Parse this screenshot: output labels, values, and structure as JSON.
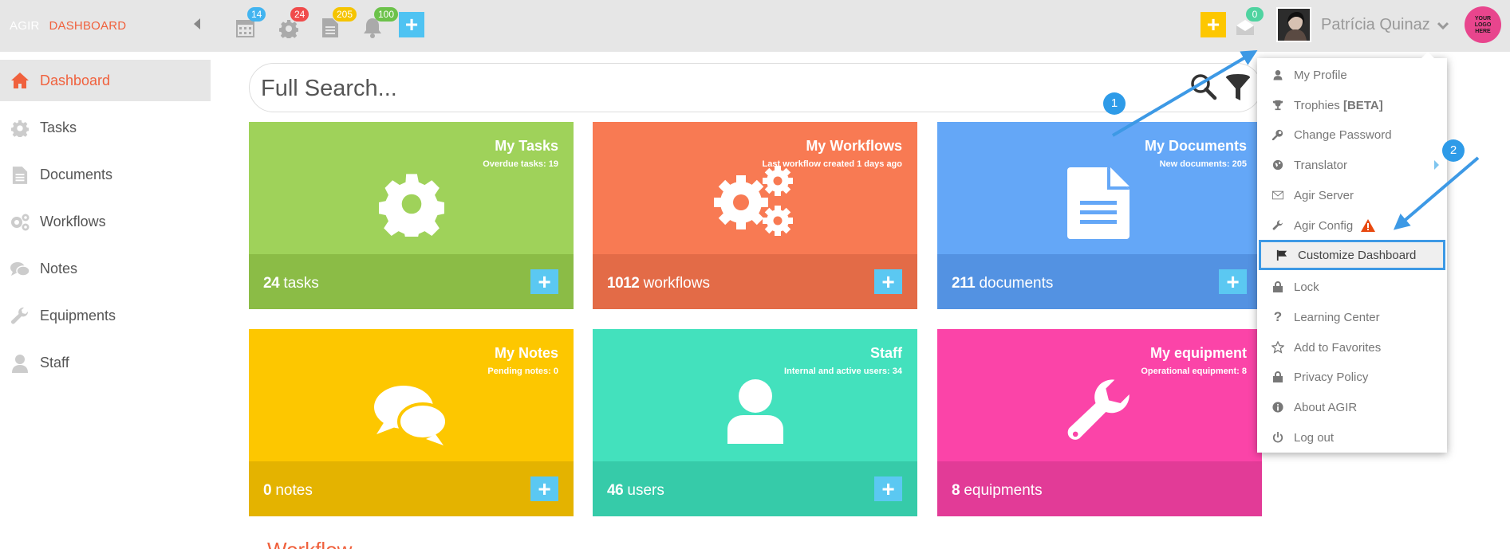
{
  "brand": {
    "part1": "AGIR",
    "part2": "DASHBOARD"
  },
  "topbar": {
    "badges": {
      "calendar": "14",
      "settings": "24",
      "documents": "205",
      "notifications": "100",
      "messages": "0"
    },
    "user_name": "Patrícia Quinaz",
    "logo_text": "YOUR LOGO HERE"
  },
  "sidebar": {
    "items": [
      {
        "label": "Dashboard",
        "icon": "home-icon"
      },
      {
        "label": "Tasks",
        "icon": "gear-icon"
      },
      {
        "label": "Documents",
        "icon": "document-icon"
      },
      {
        "label": "Workflows",
        "icon": "gears-icon"
      },
      {
        "label": "Notes",
        "icon": "chat-icon"
      },
      {
        "label": "Equipments",
        "icon": "wrench-icon"
      },
      {
        "label": "Staff",
        "icon": "user-icon"
      }
    ]
  },
  "search": {
    "placeholder": "Full Search..."
  },
  "tiles": [
    {
      "title": "My Tasks",
      "subtitle": "Overdue tasks: 19",
      "count": "24",
      "unit": "tasks"
    },
    {
      "title": "My Workflows",
      "subtitle": "Last workflow created 1 days ago",
      "count": "1012",
      "unit": "workflows"
    },
    {
      "title": "My Documents",
      "subtitle": "New documents: 205",
      "count": "211",
      "unit": "documents"
    },
    {
      "title": "My Notes",
      "subtitle": "Pending notes: 0",
      "count": "0",
      "unit": "notes"
    },
    {
      "title": "Staff",
      "subtitle": "Internal and active users: 34",
      "count": "46",
      "unit": "users"
    },
    {
      "title": "My equipment",
      "subtitle": "Operational equipment: 8",
      "count": "8",
      "unit": "equipments"
    }
  ],
  "bottom_text": "Workflow",
  "dropdown": {
    "items": [
      {
        "label": "My Profile",
        "icon": "user-icon"
      },
      {
        "label": "Trophies",
        "tag": "[BETA]",
        "icon": "trophy-icon"
      },
      {
        "label": "Change Password",
        "icon": "key-icon"
      },
      {
        "label": "Translator",
        "icon": "globe-icon"
      },
      {
        "label": "Agir Server",
        "icon": "envelope-icon"
      },
      {
        "label": "Agir Config",
        "icon": "wrench-icon"
      },
      {
        "label": "Customize Dashboard",
        "icon": "flag-icon"
      },
      {
        "label": "Lock",
        "icon": "lock-icon"
      },
      {
        "label": "Learning Center",
        "icon": "question-icon"
      },
      {
        "label": "Add to Favorites",
        "icon": "star-icon"
      },
      {
        "label": "Privacy Policy",
        "icon": "lock-icon"
      },
      {
        "label": "About AGIR",
        "icon": "info-icon"
      },
      {
        "label": "Log out",
        "icon": "power-icon"
      }
    ]
  },
  "annotations": {
    "step1": "1",
    "step2": "2"
  },
  "colors": {
    "accent": "#f0613d",
    "tasks": "#9fd25a",
    "tasks_foot": "#8bbc46",
    "workflows": "#f87a53",
    "workflows_foot": "#e36b47",
    "documents": "#64a7f7",
    "documents_foot": "#5392e2",
    "notes": "#fdc700",
    "notes_foot": "#e4b300",
    "staff": "#43e1bd",
    "staff_foot": "#36cba9",
    "equipment": "#fb44a8",
    "equipment_foot": "#e23b97"
  }
}
